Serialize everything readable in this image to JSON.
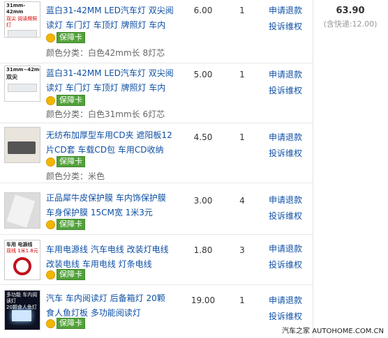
{
  "items": [
    {
      "title_lines": [
        "蓝白31-42MM LED汽车灯 双尖阅",
        "读灯 车门灯 车顶灯 牌照灯 车内"
      ],
      "guard": "保障卡",
      "variant": "颜色分类：白色42mm长 8灯芯",
      "price": "6.00",
      "qty": "1",
      "refund": "申请退款",
      "complain": "投诉维权",
      "thumb_caption": [
        "31mm-42mm",
        "双尖 阅读牌照灯"
      ]
    },
    {
      "title_lines": [
        "蓝白31-42MM LED汽车灯 双尖阅",
        "读灯 车门灯 车顶灯 牌照灯 车内"
      ],
      "guard": "保障卡",
      "variant": "颜色分类：白色31mm长 6灯芯",
      "price": "5.00",
      "qty": "1",
      "refund": "申请退款",
      "complain": "投诉维权",
      "thumb_caption": [
        "31mm~42mm",
        "双尖"
      ]
    },
    {
      "title_lines": [
        "无纺布加厚型车用CD夹 遮阳板12",
        "片CD套 车载CD包 车用CD收纳"
      ],
      "guard": "保障卡",
      "variant": "颜色分类：米色",
      "price": "4.50",
      "qty": "1",
      "refund": "申请退款",
      "complain": "投诉维权",
      "thumb_caption": []
    },
    {
      "title_lines": [
        "正品犀牛皮保护膜 车内饰保护膜",
        "车身保护膜 15CM宽 1米3元"
      ],
      "guard": "保障卡",
      "variant": "",
      "price": "3.00",
      "qty": "4",
      "refund": "申请退款",
      "complain": "投诉维权",
      "thumb_caption": []
    },
    {
      "title_lines": [
        "车用电源线 汽车电线 改装灯电线",
        "改装电线 车用电线 灯条电线"
      ],
      "guard": "保障卡",
      "variant": "",
      "price": "1.80",
      "qty": "3",
      "refund": "申请退款",
      "complain": "投诉维权",
      "thumb_caption": [
        "车用 电源线",
        "双线 1米1.8元"
      ]
    },
    {
      "title_lines": [
        "汽车 车内阅读灯 后备箱灯 20颗",
        "食人鱼灯板 多功能阅读灯"
      ],
      "guard": "保障卡",
      "variant": "",
      "price": "19.00",
      "qty": "1",
      "refund": "申请退款",
      "complain": "投诉维权",
      "thumb_caption": [
        "多功能 车内阅读灯",
        "20颗食人鱼灯"
      ]
    }
  ],
  "total": {
    "amount": "63.90",
    "shipping": "(含快递:12.00)"
  },
  "watermark": "汽车之家 AUTOHOME.COM.CN",
  "colors": {
    "link": "#0e50a5",
    "guard_green": "#52a13a",
    "guard_dot": "#f2b600"
  }
}
